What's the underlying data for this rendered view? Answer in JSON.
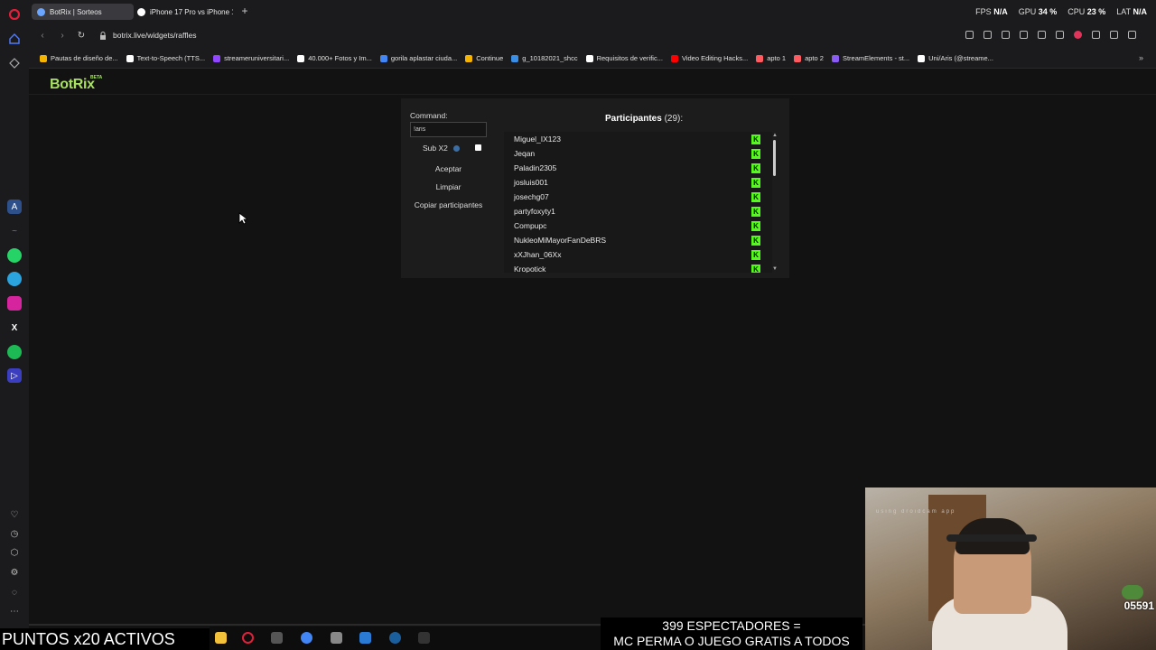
{
  "browser": {
    "tabs": [
      {
        "label": "BotRix | Sorteos",
        "active": true,
        "favicon_color": "#6aa6ff"
      },
      {
        "label": "iPhone 17 Pro vs iPhone 1",
        "active": false,
        "favicon_color": "#ffffff"
      }
    ],
    "stats": {
      "fps_label": "FPS",
      "fps_value": "N/A",
      "gpu_label": "GPU",
      "gpu_value": "34 %",
      "cpu_label": "CPU",
      "cpu_value": "23 %",
      "lat_label": "LAT",
      "lat_value": "N/A"
    },
    "url": "botrix.live/widgets/raffles",
    "bookmarks": [
      {
        "label": "Pautas de diseño de...",
        "icon_color": "#f4b400"
      },
      {
        "label": "Text-to-Speech (TTS...",
        "icon_color": "#ffffff"
      },
      {
        "label": "streameruniversitari...",
        "icon_color": "#9146ff"
      },
      {
        "label": "40.000+ Fotos y Im...",
        "icon_color": "#ffffff"
      },
      {
        "label": "gorila aplastar ciuda...",
        "icon_color": "#4285f4"
      },
      {
        "label": "Continue",
        "icon_color": "#f4b400"
      },
      {
        "label": "g_10182021_shcc",
        "icon_color": "#3a8ee6"
      },
      {
        "label": "Requisitos de verific...",
        "icon_color": "#ffffff"
      },
      {
        "label": "Video Editing Hacks...",
        "icon_color": "#ff0000"
      },
      {
        "label": "apto 1",
        "icon_color": "#ff5a5f"
      },
      {
        "label": "apto 2",
        "icon_color": "#ff5a5f"
      },
      {
        "label": "StreamElements - st...",
        "icon_color": "#8a5cf5"
      },
      {
        "label": "Uni/Aris (@streame...",
        "icon_color": "#ffffff"
      }
    ]
  },
  "app": {
    "logo": "BotRix",
    "logo_badge": "BETA",
    "accent_color": "#a8e063",
    "command_label": "Command:",
    "command_value": "!aris",
    "sub_label": "Sub X2",
    "sub_checked": true,
    "buttons": {
      "accept": "Aceptar",
      "clear": "Limpiar",
      "copy": "Copiar participantes"
    },
    "participants_title": "Participantes",
    "participants_count": "(29):",
    "platform_icon": "K",
    "participants": [
      "Miguel_IX123",
      "Jeqan",
      "Paladin2305",
      "josluis001",
      "josechg07",
      "partyfoxyty1",
      "Compupc",
      "NukleoMiMayorFanDeBRS",
      "xXJhan_06Xx",
      "Kropotick"
    ]
  },
  "stream": {
    "points_banner": "PUNTOS x20 ACTIVOS",
    "viewers_line1": "399 ESPECTADORES =",
    "viewers_line2": "MC PERMA O JUEGO GRATIS A TODOS",
    "webcam_caption": "using droidcam app",
    "counter": "05591"
  }
}
